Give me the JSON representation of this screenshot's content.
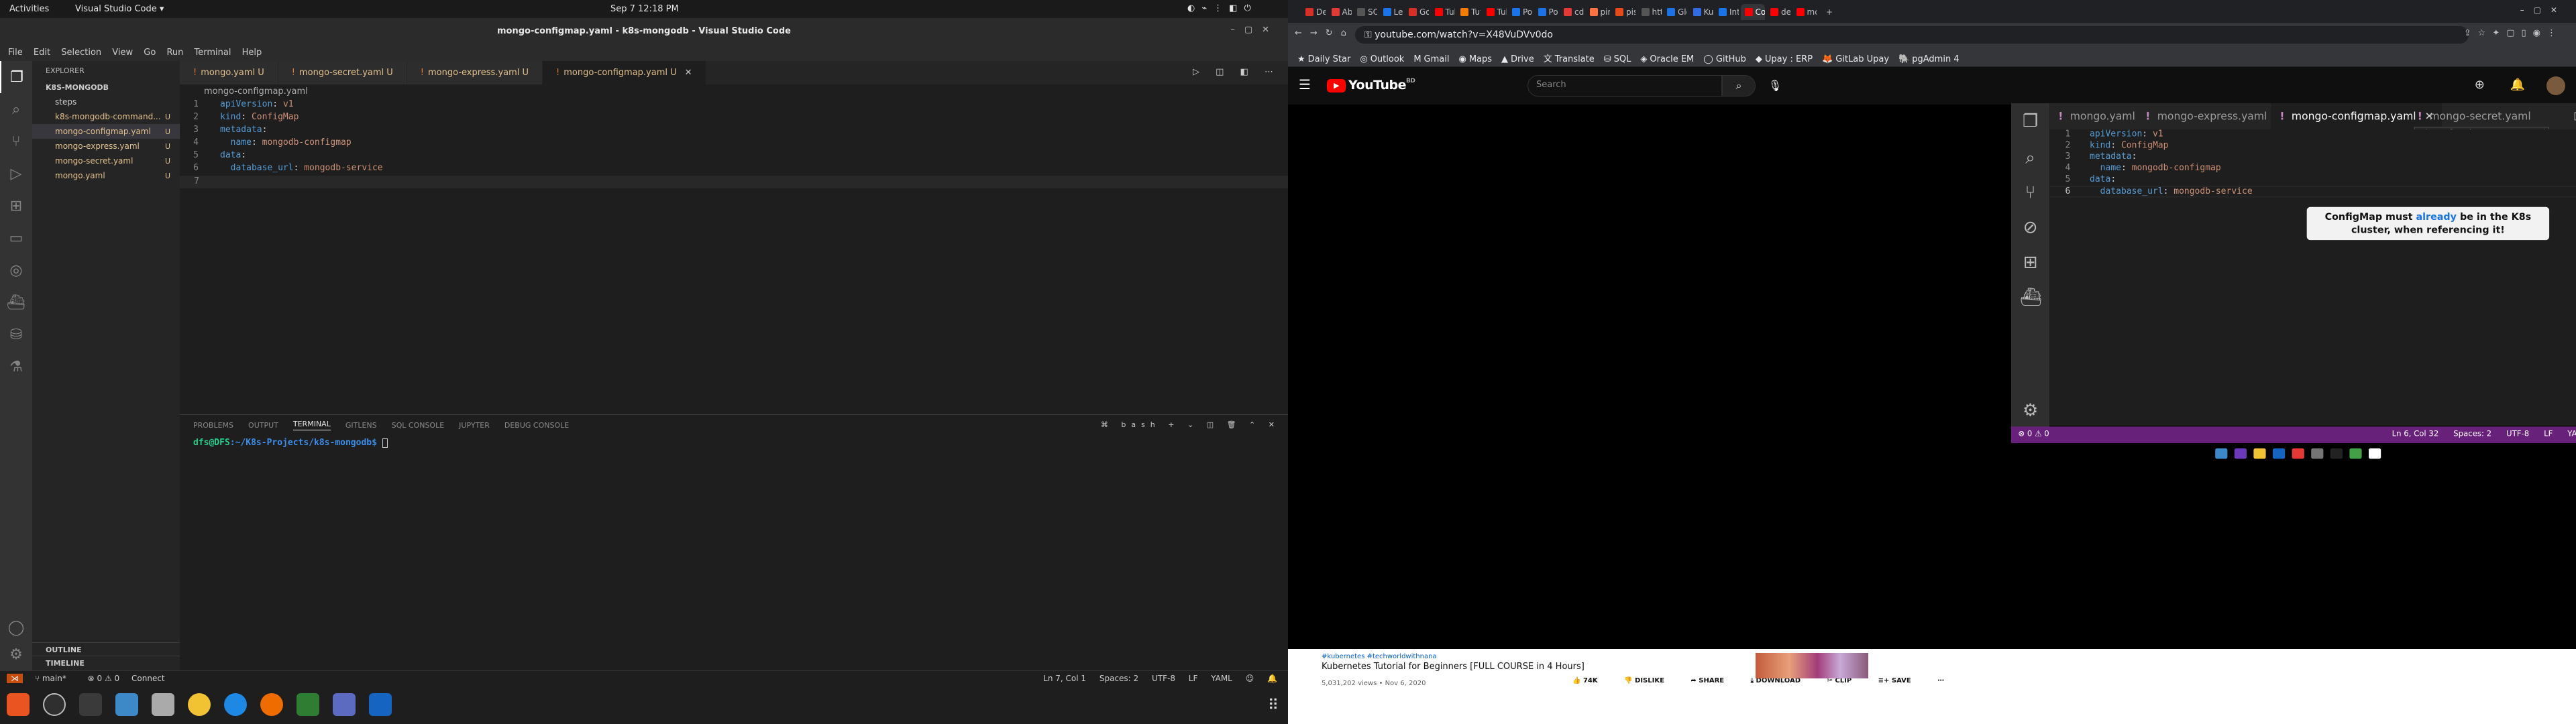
{
  "topbar": {
    "activities": "Activities",
    "app_menu": "Visual Studio Code ▾",
    "clock": "Sep 7  12:18 PM"
  },
  "vscode": {
    "window_title": "mongo-configmap.yaml - k8s-mongodb - Visual Studio Code",
    "menu": [
      "File",
      "Edit",
      "Selection",
      "View",
      "Go",
      "Run",
      "Terminal",
      "Help"
    ],
    "explorer_header": "EXPLORER",
    "project": "K8S-MONGODB",
    "files": [
      {
        "name": "steps",
        "badge": "",
        "dir": true
      },
      {
        "name": "k8s-mongodb-command...",
        "badge": "U",
        "dir": false
      },
      {
        "name": "mongo-configmap.yaml",
        "badge": "U",
        "dir": false,
        "selected": true
      },
      {
        "name": "mongo-express.yaml",
        "badge": "U",
        "dir": false
      },
      {
        "name": "mongo-secret.yaml",
        "badge": "U",
        "dir": false
      },
      {
        "name": "mongo.yaml",
        "badge": "U",
        "dir": false
      }
    ],
    "outline": "OUTLINE",
    "timeline": "TIMELINE",
    "tabs": [
      {
        "label": "mongo.yaml U"
      },
      {
        "label": "mongo-secret.yaml U"
      },
      {
        "label": "mongo-express.yaml U"
      },
      {
        "label": "mongo-configmap.yaml U",
        "active": true
      }
    ],
    "breadcrumb": "mongo-configmap.yaml",
    "code": [
      {
        "n": "1",
        "k": "apiVersion",
        "v": "v1",
        "indent": ""
      },
      {
        "n": "2",
        "k": "kind",
        "v": "ConfigMap",
        "indent": ""
      },
      {
        "n": "3",
        "k": "metadata",
        "v": "",
        "indent": ""
      },
      {
        "n": "4",
        "k": "name",
        "v": "mongodb-configmap",
        "indent": "  "
      },
      {
        "n": "5",
        "k": "data",
        "v": "",
        "indent": ""
      },
      {
        "n": "6",
        "k": "database_url",
        "v": "mongodb-service",
        "indent": "  "
      },
      {
        "n": "7",
        "k": "",
        "v": "",
        "indent": ""
      }
    ],
    "panel_tabs": [
      "PROBLEMS",
      "OUTPUT",
      "TERMINAL",
      "GITLENS",
      "SQL CONSOLE",
      "JUPYTER",
      "DEBUG CONSOLE"
    ],
    "panel_active": "TERMINAL",
    "shell": "bash",
    "prompt_user": "dfs@DFS",
    "prompt_path": ":~/K8s-Projects/k8s-mongodb$",
    "status": {
      "branch": "main*",
      "problems": "⊗ 0 ⚠ 0",
      "connect": "Connect",
      "position": "Ln 7, Col 1",
      "spaces": "Spaces: 2",
      "encoding": "UTF-8",
      "eol": "LF",
      "language": "YAML"
    }
  },
  "chrome": {
    "tabs": [
      "Des",
      "Abs",
      "SOL",
      "Lea",
      "Go t",
      "Tub",
      "Tut",
      "Tub",
      "Pos",
      "Pos",
      "cdf",
      "pin",
      "pis",
      "http",
      "Glo",
      "Kub",
      "Inte",
      "Con",
      "den",
      "mo"
    ],
    "url": "youtube.com/watch?v=X48VuDVv0do",
    "bookmarks": [
      "Daily Star",
      "Outlook",
      "Gmail",
      "Maps",
      "Drive",
      "Translate",
      "SQL",
      "Oracle EM",
      "GitHub",
      "Upay : ERP",
      "GitLab Upay",
      "pgAdmin 4"
    ]
  },
  "youtube": {
    "logo": "YouTube",
    "country": "BD",
    "search_placeholder": "Search",
    "video": {
      "tabs": [
        "mongo.yaml",
        "mongo-express.yaml",
        "mongo-configmap.yaml",
        "mongo-secret.yaml"
      ],
      "tooltip": "~/k8s-configuration/mongo-express.yaml",
      "code": [
        {
          "n": "1",
          "k": "apiVersion",
          "v": "v1",
          "indent": ""
        },
        {
          "n": "2",
          "k": "kind",
          "v": "ConfigMap",
          "indent": ""
        },
        {
          "n": "3",
          "k": "metadata",
          "v": "",
          "indent": ""
        },
        {
          "n": "4",
          "k": "name",
          "v": "mongodb-configmap",
          "indent": "  "
        },
        {
          "n": "5",
          "k": "data",
          "v": "",
          "indent": ""
        },
        {
          "n": "6",
          "k": "database_url",
          "v": "mongodb-service",
          "indent": "  "
        }
      ],
      "caption_a": "ConfigMap must ",
      "caption_hl": "already",
      "caption_b": " be in the K8s cluster, when referencing it!",
      "status_left": "⊗ 0  ⚠ 0",
      "status_right": [
        "Ln 6, Col 32",
        "Spaces: 2",
        "UTF-8",
        "LF",
        "YAML"
      ]
    },
    "tags": "#kubernetes #techworldwithnana",
    "title": "Kubernetes Tutorial for Beginners [FULL COURSE in 4 Hours]",
    "meta": "5,031,202 views • Nov 6, 2020",
    "actions": [
      "74K",
      "DISLIKE",
      "SHARE",
      "DOWNLOAD",
      "CLIP",
      "SAVE"
    ]
  }
}
